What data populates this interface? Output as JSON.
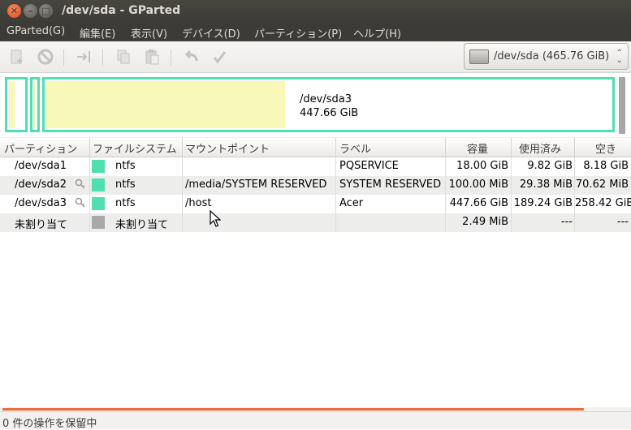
{
  "window": {
    "title": "/dev/sda - GParted"
  },
  "menu": {
    "items": [
      "GParted(G)",
      "編集(E)",
      "表示(V)",
      "デバイス(D)",
      "パーティション(P)",
      "ヘルプ(H)"
    ]
  },
  "toolbar": {
    "buttons": [
      "new-icon",
      "delete-icon",
      "resize-move-icon",
      "copy-icon",
      "paste-icon",
      "undo-icon",
      "apply-icon"
    ]
  },
  "device": {
    "path": "/dev/sda",
    "size": "(465.76 GiB)"
  },
  "diskmap": {
    "name": "/dev/sda3",
    "size": "447.66 GiB",
    "colors": {
      "ntfs": "#4ee0b0",
      "used": "#f8f8b8",
      "unallocated": "#a8a8a8"
    }
  },
  "table": {
    "headers": [
      "パーティション",
      "ファイルシステム",
      "マウントポイント",
      "ラベル",
      "容量",
      "使用済み",
      "空き"
    ],
    "rows": [
      {
        "partition": "/dev/sda1",
        "fs": "ntfs",
        "mount": "",
        "label": "PQSERVICE",
        "size": "18.00 GiB",
        "used": "9.82 GiB",
        "free": "8.18 GiB",
        "locked": false,
        "color": "#4ee0b0"
      },
      {
        "partition": "/dev/sda2",
        "fs": "ntfs",
        "mount": "/media/SYSTEM RESERVED",
        "label": "SYSTEM RESERVED",
        "size": "100.00 MiB",
        "used": "29.38 MiB",
        "free": "70.62 MiB",
        "locked": true,
        "color": "#4ee0b0"
      },
      {
        "partition": "/dev/sda3",
        "fs": "ntfs",
        "mount": "/host",
        "label": "Acer",
        "size": "447.66 GiB",
        "used": "189.24 GiB",
        "free": "258.42 GiB",
        "locked": true,
        "color": "#4ee0b0"
      },
      {
        "partition": "未割り当て",
        "fs": "未割り当て",
        "mount": "",
        "label": "",
        "size": "2.49 MiB",
        "used": "---",
        "free": "---",
        "locked": false,
        "color": "#a8a8a8"
      }
    ]
  },
  "status": {
    "text": "0 件の操作を保留中"
  }
}
